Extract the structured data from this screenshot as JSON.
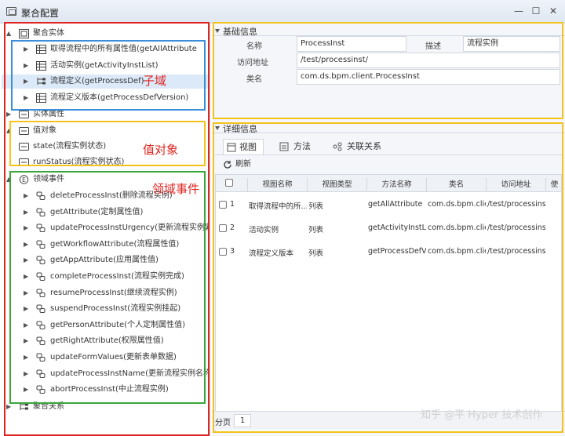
{
  "window": {
    "title": "聚合配置",
    "minimize": "—",
    "maximize": "☐",
    "close": "✕"
  },
  "tree": {
    "root": "聚合实体",
    "entity_items": [
      "取得流程中的所有属性值(getAllAttribute",
      "活动实例(getActivityInstList)",
      "流程定义(getProcessDef)",
      "流程定义版本(getProcessDefVersion)"
    ],
    "entity_props": "实体属性",
    "value_object": "值对象",
    "value_items": [
      "state(流程实例状态)",
      "runStatus(流程实例状态)"
    ],
    "domain_events": "领域事件",
    "event_items": [
      "deleteProcessInst(删除流程实例)",
      "getAttribute(定制属性值)",
      "updateProcessInstUrgency(更新流程实例紧急程",
      "getWorkflowAttribute(流程属性值)",
      "getAppAttribute(应用属性值)",
      "completeProcessInst(流程实例完成)",
      "resumeProcessInst(继续流程实例)",
      "suspendProcessInst(流程实例挂起)",
      "getPersonAttribute(个人定制属性值)",
      "getRightAttribute(权限属性值)",
      "updateFormValues(更新表单数据)",
      "updateProcessInstName(更新流程实例名称（",
      "abortProcessInst(中止流程实例)"
    ],
    "aggregate_relations": "聚合关系"
  },
  "annotations": {
    "subdomain": "子域",
    "value_object": "值对象",
    "domain_events": "领域事件"
  },
  "basic": {
    "header": "基础信息",
    "name_label": "名称",
    "name_value": "ProcessInst",
    "desc_label": "描述",
    "desc_value": "流程实例",
    "url_label": "访问地址",
    "url_value": "/test/processinst/",
    "class_label": "类名",
    "class_value": "com.ds.bpm.client.ProcessInst"
  },
  "detail": {
    "header": "详细信息",
    "tabs": [
      "视图",
      "方法",
      "关联关系"
    ],
    "refresh": "刷新",
    "columns": [
      "视图名称",
      "视图类型",
      "方法名称",
      "类名",
      "访问地址",
      "使"
    ],
    "rows": [
      [
        "1",
        "取得流程中的所...",
        "列表",
        "getAllAttribute",
        "com.ds.bpm.clie...",
        "/test/processins..."
      ],
      [
        "2",
        "活动实例",
        "列表",
        "getActivityInstList",
        "com.ds.bpm.clie...",
        "/test/processins..."
      ],
      [
        "3",
        "流程定义版本",
        "列表",
        "getProcessDefV...",
        "com.ds.bpm.clie...",
        "/test/processins..."
      ]
    ]
  },
  "footer": {
    "page_label": "分页",
    "page_number": "1"
  },
  "watermark": "知乎 @平 Hyper 技术创作",
  "colors": {
    "red": "#e0241f",
    "blue": "#3b8fd9",
    "yellow": "#f4c21b",
    "green": "#3aa63a",
    "selection": "#dbe9f8"
  }
}
